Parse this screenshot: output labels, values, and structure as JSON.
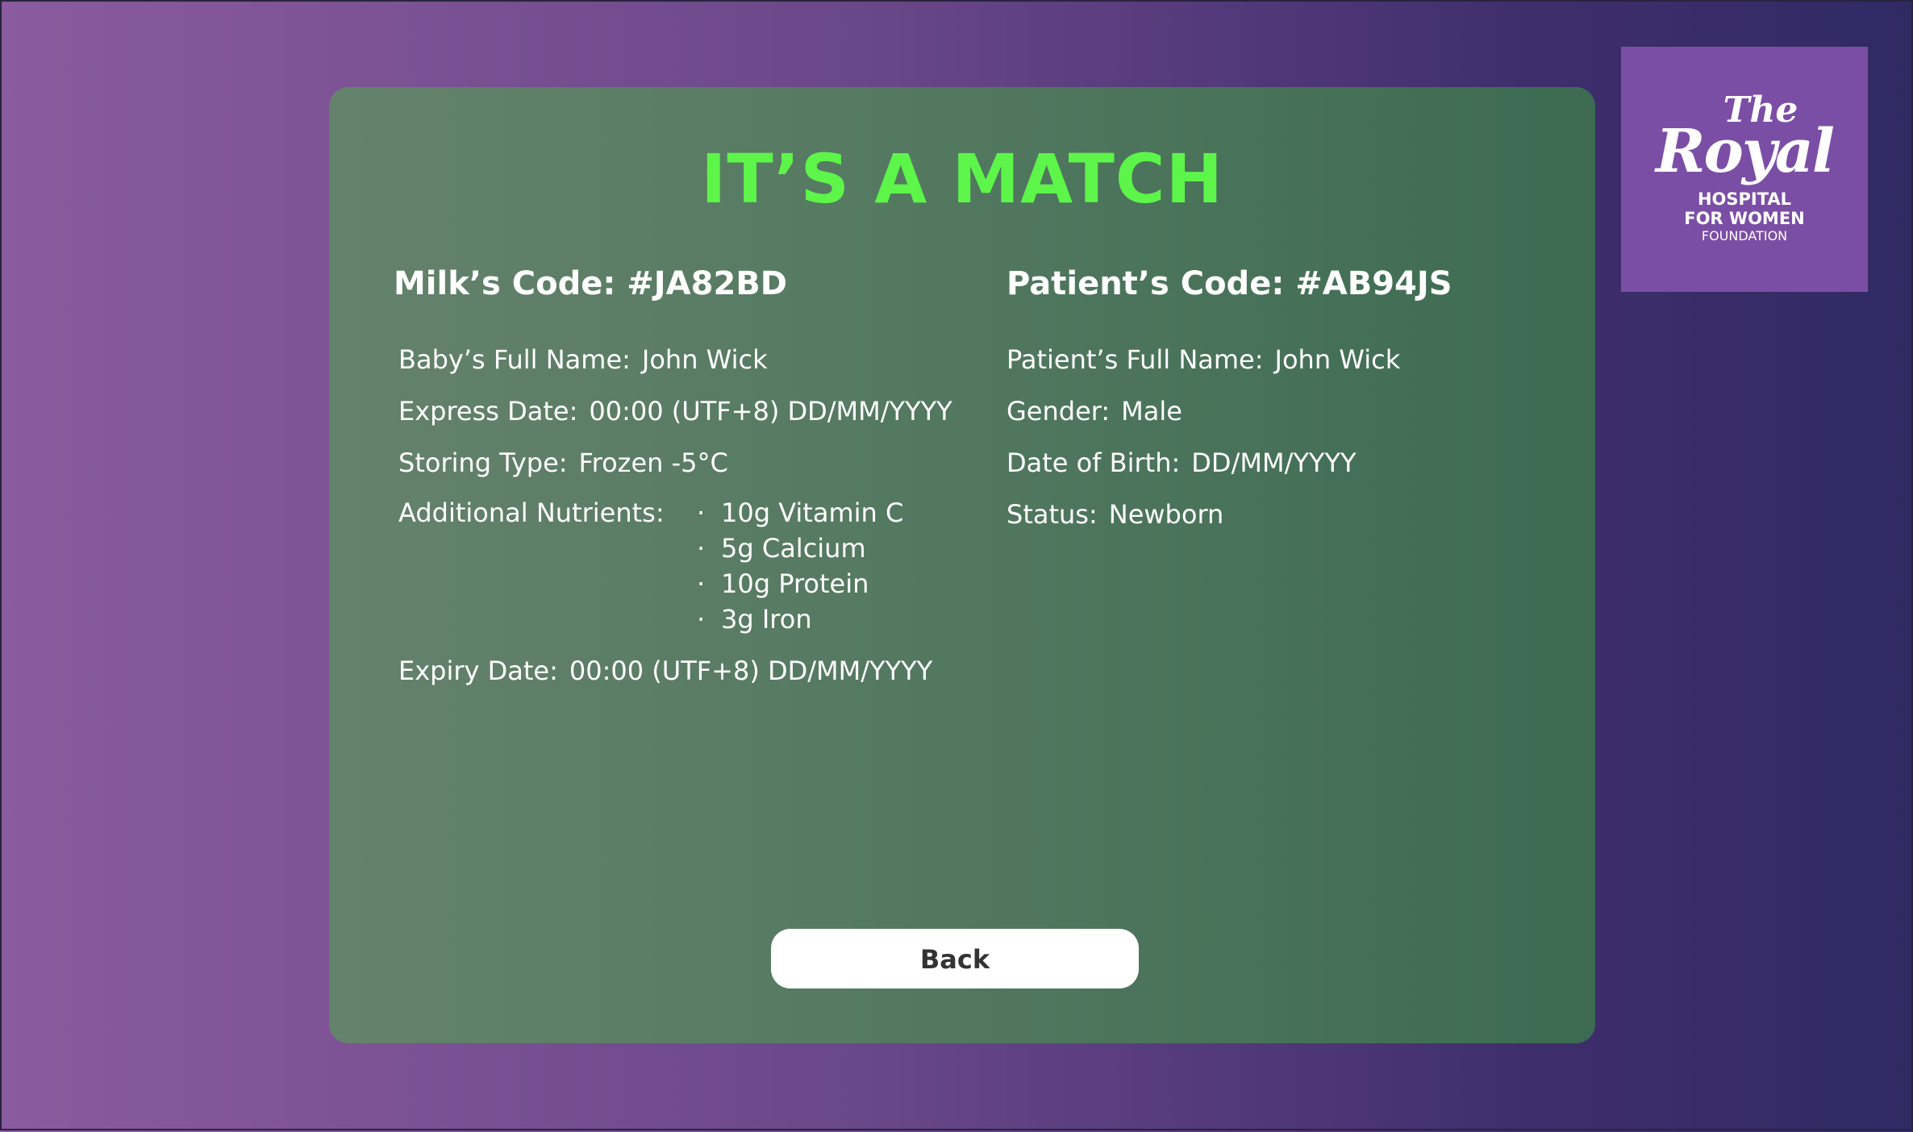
{
  "logo": {
    "the": "The",
    "royal": "Royal",
    "line1": "HOSPITAL",
    "line2": "FOR WOMEN",
    "line3": "FOUNDATION"
  },
  "match": {
    "title": "IT’S A MATCH",
    "milk_code_label": "Milk’s Code: #JA82BD",
    "patient_code_label": "Patient’s Code: #AB94JS"
  },
  "milk": {
    "baby_name_label": "Baby’s Full Name:",
    "baby_name": "John Wick",
    "express_date_label": "Express Date:",
    "express_date": "00:00 (UTF+8) DD/MM/YYYY",
    "storing_type_label": "Storing Type:",
    "storing_type": "Frozen  -5°C",
    "nutrients_label": "Additional Nutrients:",
    "nutrients": [
      "10g Vitamin C",
      "5g Calcium",
      "10g Protein",
      "3g Iron"
    ],
    "expiry_date_label": "Expiry Date:",
    "expiry_date": "00:00 (UTF+8) DD/MM/YYYY"
  },
  "patient": {
    "full_name_label": "Patient’s Full Name:",
    "full_name": "John Wick",
    "gender_label": "Gender:",
    "gender": "Male",
    "dob_label": "Date of Birth:",
    "dob": "DD/MM/YYYY",
    "status_label": "Status:",
    "status": "Newborn"
  },
  "actions": {
    "back_label": "Back"
  },
  "colors": {
    "title_green": "#5df54a",
    "card_bg": "#567a62",
    "logo_purple": "#7b4ea6"
  }
}
